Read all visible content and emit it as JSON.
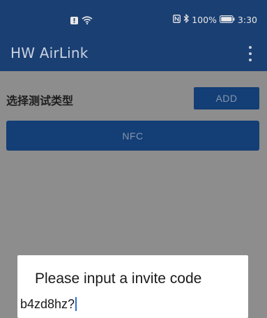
{
  "status": {
    "battery_text": "100%",
    "time": "3:30",
    "left_icons": [
      "notification-alert-icon",
      "wifi-icon"
    ],
    "right_icons": [
      "nfc-icon",
      "bluetooth-icon",
      "battery-icon"
    ]
  },
  "appbar": {
    "title": "HW AirLink",
    "menu_icon": "more-vertical-icon"
  },
  "main": {
    "section_label": "选择测试类型",
    "add_label": "ADD",
    "nfc_label": "NFC"
  },
  "dialog": {
    "title": "Please input a invite code",
    "input_value": "b4zd8hz?"
  },
  "colors": {
    "primary": "#1a3f73",
    "button": "#133e76",
    "scrim": "#8d8d8d"
  }
}
